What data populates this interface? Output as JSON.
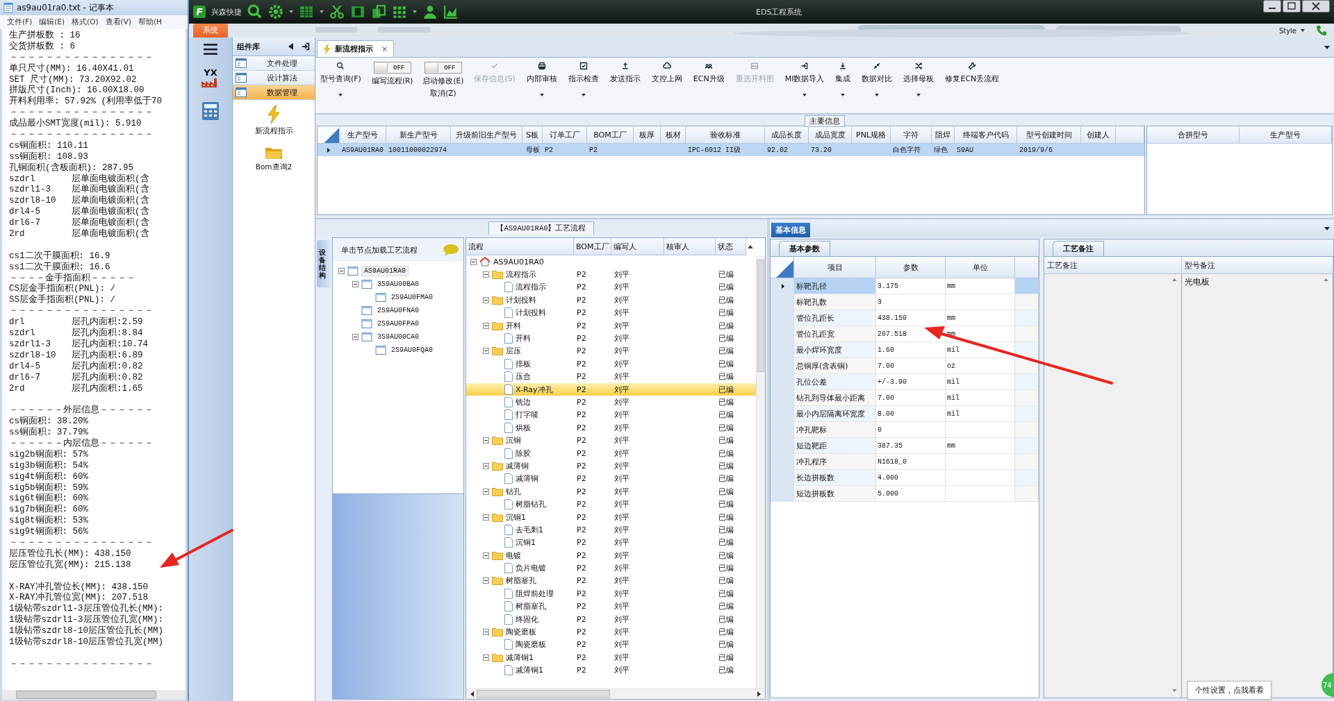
{
  "notepad": {
    "title": "as9au01ra0.txt - 记事本",
    "menu": [
      "文件(F)",
      "编辑(E)",
      "格式(O)",
      "查看(V)",
      "帮助(H"
    ],
    "blocks": [
      [
        "生产拼板数 : 16",
        "交货拼板数 : 6",
        "－－－－－－－－－－－－－－－－",
        "单只尺寸(MM): 16.40X41.01",
        "SET 尺寸(MM): 73.20X92.02",
        "拼版尺寸(Inch): 16.00X18.00",
        "开料利用率: 57.92% (利用率低于70",
        "－－－－－－－－－－－－－－－－",
        "成品最小SMT宽度(mil): 5.910",
        "－－－－－－－－－－－－－－－－",
        "cs铜面积: 110.11",
        "ss铜面积: 108.93",
        "孔铜面积(含板面积): 287.95",
        "szdrl       层单面电镀面积(含",
        "szdrl1-3    层单面电镀面积(含",
        "szdrl8-10   层单面电镀面积(含",
        "drl4-5      层单面电镀面积(含",
        "drl6-7      层单面电镀面积(含",
        "2rd         层单面电镀面积(含"
      ],
      [
        "cs1二次干膜面积: 16.9",
        "ss1二次干膜面积: 16.6",
        "－－－－金手指面积－－－－－",
        "CS层金手指面积(PNL): /",
        "SS层金手指面积(PNL): /",
        "－－－－－－－－－－－－－－－－",
        "drl         层孔内面积:2.59",
        "szdrl       层孔内面积:8.84",
        "szdrl1-3    层孔内面积:10.74",
        "szdrl8-10   层孔内面积:6.89",
        "drl4-5      层孔内面积:0.82",
        "drl6-7      层孔内面积:0.82",
        "2rd         层孔内面积:1.65"
      ],
      [
        "－－－－－－外层信息－－－－－－",
        "cs铜面积: 38.20%",
        "ss铜面积: 37.79%",
        "－－－－－－内层信息－－－－－－",
        "sig2b铜面积: 57%",
        "sig3b铜面积: 54%",
        "sig4t铜面积: 60%",
        "sig5b铜面积: 59%",
        "sig6t铜面积: 60%",
        "sig7b铜面积: 60%",
        "sig8t铜面积: 53%",
        "sig9t铜面积: 56%",
        "－－－－－－－－－－－－－－－－",
        "层压管位孔长(MM): 438.150",
        "层压管位孔宽(MM): 215.138"
      ],
      [
        "X-RAY冲孔管位长(MM): 438.150",
        "X-RAY冲孔管位宽(MM): 207.518",
        "1级钻带szdrl1-3层压管位孔长(MM):",
        "1级钻带szdrl1-3层压管位孔宽(MM):",
        "1级钻带szdrl8-10层压管位孔长(MM)",
        "1级钻带szdrl8-10层压管位孔宽(MM)"
      ],
      [
        "－－－－－－－－－－－－－－－－"
      ]
    ]
  },
  "app": {
    "logo_letter": "F",
    "brand": "兴森快捷",
    "title": "EDS工程系统",
    "system_tab": "系统",
    "style_menu": "Style"
  },
  "nav": {
    "logo_text": "YX"
  },
  "components": {
    "title": "组件库",
    "items": [
      {
        "label": "文件处理",
        "selected": false
      },
      {
        "label": "设计算法",
        "selected": false
      },
      {
        "label": "数据管理",
        "selected": true
      }
    ],
    "actions": [
      {
        "label": "新流程指示"
      },
      {
        "label": "Bom查询2"
      }
    ]
  },
  "doc_tab": {
    "label": "新流程指示",
    "close": "×"
  },
  "toolbar": [
    {
      "kind": "button",
      "label": "型号查询(F)",
      "disabled": false,
      "dropdown": true
    },
    {
      "kind": "toggle",
      "label": "编写流程(R)",
      "on": false,
      "state_text": "OFF"
    },
    {
      "kind": "toggle",
      "label": "启动修改(E)",
      "second_line": "取消(Z)",
      "on": false,
      "state_text": "OFF"
    },
    {
      "kind": "button",
      "label": "保存信息(S)",
      "disabled": true,
      "dropdown": false
    },
    {
      "kind": "button",
      "label": "内部审核",
      "disabled": false,
      "dropdown": true
    },
    {
      "kind": "button",
      "label": "指示检查",
      "disabled": false,
      "dropdown": true
    },
    {
      "kind": "button",
      "label": "发送指示",
      "disabled": false,
      "dropdown": false
    },
    {
      "kind": "button",
      "label": "文控上网",
      "disabled": false,
      "dropdown": false
    },
    {
      "kind": "button",
      "label": "ECN升级",
      "disabled": false,
      "dropdown": false
    },
    {
      "kind": "button",
      "label": "重选开料图",
      "disabled": true,
      "dropdown": false
    },
    {
      "kind": "button",
      "label": "MI数据导入",
      "disabled": false,
      "dropdown": true
    },
    {
      "kind": "button",
      "label": "集成",
      "disabled": false,
      "dropdown": true
    },
    {
      "kind": "button",
      "label": "数据对比",
      "disabled": false,
      "dropdown": true
    },
    {
      "kind": "button",
      "label": "选择母板",
      "disabled": false,
      "dropdown": true
    },
    {
      "kind": "button",
      "label": "修复ECN丢流程",
      "disabled": false,
      "dropdown": false
    }
  ],
  "main_info": {
    "title": "主要信息",
    "columns": [
      "生产型号",
      "新生产型号",
      "升级前旧生产型号",
      "S板",
      "订单工厂",
      "BOM工厂",
      "板厚",
      "板材",
      "验收标准",
      "成品长度",
      "成品宽度",
      "PNL规格",
      "字符",
      "阻焊",
      "终端客户代码",
      "型号创建时间",
      "创建人"
    ],
    "rows": [
      {
        "selected": true,
        "cells": [
          "AS9AU01RA0",
          "10011000022974",
          null,
          "母板",
          "P2",
          "P2",
          null,
          null,
          "IPC-6012 II级",
          "92.02",
          "73.20",
          null,
          "白色字符",
          "绿色",
          "S9AU",
          "2019/9/6",
          null
        ]
      }
    ],
    "side_columns": [
      "合拼型号",
      "生产型号"
    ]
  },
  "process": {
    "title": "【AS9AU01RA0】工艺流程",
    "side_tab": "设备结构",
    "structure_hint": "单击节点加载工艺流程",
    "structure": [
      {
        "label": "AS9AU01RA0",
        "selected": true,
        "children": [
          {
            "label": "3S9AU00BA0",
            "selected": false,
            "children": [
              {
                "label": "2S9AU0FMA0",
                "selected": false
              }
            ]
          },
          {
            "label": "2S9AU0FNA0",
            "selected": false
          },
          {
            "label": "2S9AU0FPA0",
            "selected": false
          },
          {
            "label": "3S9AU00CA0",
            "selected": false,
            "children": [
              {
                "label": "2S9AU0FQA0",
                "selected": false
              }
            ]
          }
        ]
      }
    ],
    "flow_columns": [
      "流程",
      "BOM工厂",
      "编写人",
      "核审人",
      "状态"
    ],
    "flow": [
      {
        "name": "AS9AU01RA0",
        "selected": false,
        "children": [
          {
            "name": "流程指示",
            "bom": "P2",
            "writer": "刘平",
            "status": "已编",
            "selected": false,
            "children": [
              {
                "name": "流程指示",
                "bom": "P2",
                "writer": "刘平",
                "status": "已编",
                "selected": false
              }
            ]
          },
          {
            "name": "计划投料",
            "bom": "P2",
            "writer": "刘平",
            "status": "已编",
            "selected": false,
            "children": [
              {
                "name": "计划投料",
                "bom": "P2",
                "writer": "刘平",
                "status": "已编",
                "selected": false
              }
            ]
          },
          {
            "name": "开料",
            "bom": "P2",
            "writer": "刘平",
            "status": "已编",
            "selected": false,
            "children": [
              {
                "name": "开料",
                "bom": "P2",
                "writer": "刘平",
                "status": "已编",
                "selected": false
              }
            ]
          },
          {
            "name": "层压",
            "bom": "P2",
            "writer": "刘平",
            "status": "已编",
            "selected": false,
            "children": [
              {
                "name": "排板",
                "bom": "P2",
                "writer": "刘平",
                "status": "已编",
                "selected": false
              },
              {
                "name": "压合",
                "bom": "P2",
                "writer": "刘平",
                "status": "已编",
                "selected": false
              },
              {
                "name": "X-Ray冲孔",
                "bom": "P2",
                "writer": "刘平",
                "status": "已编",
                "selected": true
              },
              {
                "name": "铣边",
                "bom": "P2",
                "writer": "刘平",
                "status": "已编",
                "selected": false
              },
              {
                "name": "打字唛",
                "bom": "P2",
                "writer": "刘平",
                "status": "已编",
                "selected": false
              },
              {
                "name": "烘板",
                "bom": "P2",
                "writer": "刘平",
                "status": "已编",
                "selected": false
              }
            ]
          },
          {
            "name": "沉铜",
            "bom": "P2",
            "writer": "刘平",
            "status": "已编",
            "selected": false,
            "children": [
              {
                "name": "除胶",
                "bom": "P2",
                "writer": "刘平",
                "status": "已编",
                "selected": false
              }
            ]
          },
          {
            "name": "减薄铜",
            "bom": "P2",
            "writer": "刘平",
            "status": "已编",
            "selected": false,
            "children": [
              {
                "name": "减薄铜",
                "bom": "P2",
                "writer": "刘平",
                "status": "已编",
                "selected": false
              }
            ]
          },
          {
            "name": "钻孔",
            "bom": "P2",
            "writer": "刘平",
            "status": "已编",
            "selected": false,
            "children": [
              {
                "name": "树脂钻孔",
                "bom": "P2",
                "writer": "刘平",
                "status": "已编",
                "selected": false
              }
            ]
          },
          {
            "name": "沉铜1",
            "bom": "P2",
            "writer": "刘平",
            "status": "已编",
            "selected": false,
            "children": [
              {
                "name": "去毛刺1",
                "bom": "P2",
                "writer": "刘平",
                "status": "已编",
                "selected": false
              },
              {
                "name": "沉铜1",
                "bom": "P2",
                "writer": "刘平",
                "status": "已编",
                "selected": false
              }
            ]
          },
          {
            "name": "电镀",
            "bom": "P2",
            "writer": "刘平",
            "status": "已编",
            "selected": false,
            "children": [
              {
                "name": "负片电镀",
                "bom": "P2",
                "writer": "刘平",
                "status": "已编",
                "selected": false
              }
            ]
          },
          {
            "name": "树脂塞孔",
            "bom": "P2",
            "writer": "刘平",
            "status": "已编",
            "selected": false,
            "children": [
              {
                "name": "阻焊前处理",
                "bom": "P2",
                "writer": "刘平",
                "status": "已编",
                "selected": false
              },
              {
                "name": "树脂塞孔",
                "bom": "P2",
                "writer": "刘平",
                "status": "已编",
                "selected": false
              },
              {
                "name": "终固化",
                "bom": "P2",
                "writer": "刘平",
                "status": "已编",
                "selected": false
              }
            ]
          },
          {
            "name": "陶瓷磨板",
            "bom": "P2",
            "writer": "刘平",
            "status": "已编",
            "selected": false,
            "children": [
              {
                "name": "陶瓷磨板",
                "bom": "P2",
                "writer": "刘平",
                "status": "已编",
                "selected": false
              }
            ]
          },
          {
            "name": "减薄铜1",
            "bom": "P2",
            "writer": "刘平",
            "status": "已编",
            "selected": false,
            "children": [
              {
                "name": "减薄铜1",
                "bom": "P2",
                "writer": "刘平",
                "status": "已编",
                "selected": false
              }
            ]
          }
        ]
      }
    ]
  },
  "basic_info": {
    "tab": "基本信息",
    "subtab": "基本参数",
    "columns": [
      "项目",
      "参数",
      "单位"
    ],
    "rows": [
      {
        "item": "标靶孔径",
        "value": "3.175",
        "unit": "mm",
        "selected": true
      },
      {
        "item": "标靶孔数",
        "value": "3",
        "selected": false
      },
      {
        "item": "管位孔距长",
        "value": "438.150",
        "unit": "mm",
        "selected": false
      },
      {
        "item": "管位孔距宽",
        "value": "207.518",
        "unit": "mm",
        "selected": false
      },
      {
        "item": "最小焊环宽度",
        "value": "1.60",
        "unit": "mil",
        "selected": false
      },
      {
        "item": "总铜厚(含表铜)",
        "value": "7.00",
        "unit": "oz",
        "selected": false
      },
      {
        "item": "孔位公差",
        "value": "+/-3.90",
        "unit": "mil",
        "selected": false
      },
      {
        "item": "钻孔到导体最小距离",
        "value": "7.00",
        "unit": "mil",
        "selected": false
      },
      {
        "item": "最小内层隔离环宽度",
        "value": "8.00",
        "unit": "mil",
        "selected": false
      },
      {
        "item": "冲孔靶标",
        "value": "0",
        "selected": false
      },
      {
        "item": "短边靶距",
        "value": "387.35",
        "unit": "mm",
        "selected": false
      },
      {
        "item": "冲孔程序",
        "value": "N1618_0",
        "selected": false
      },
      {
        "item": "长边拼板数",
        "value": "4.000",
        "selected": false
      },
      {
        "item": "短边拼板数",
        "value": "5.000",
        "selected": false
      }
    ]
  },
  "remarks": {
    "tab": "工艺备注",
    "columns": [
      "工艺备注",
      "型号备注"
    ],
    "model_remark": "光电板"
  },
  "tooltip": "个性设置，点我看看",
  "badge": "74"
}
